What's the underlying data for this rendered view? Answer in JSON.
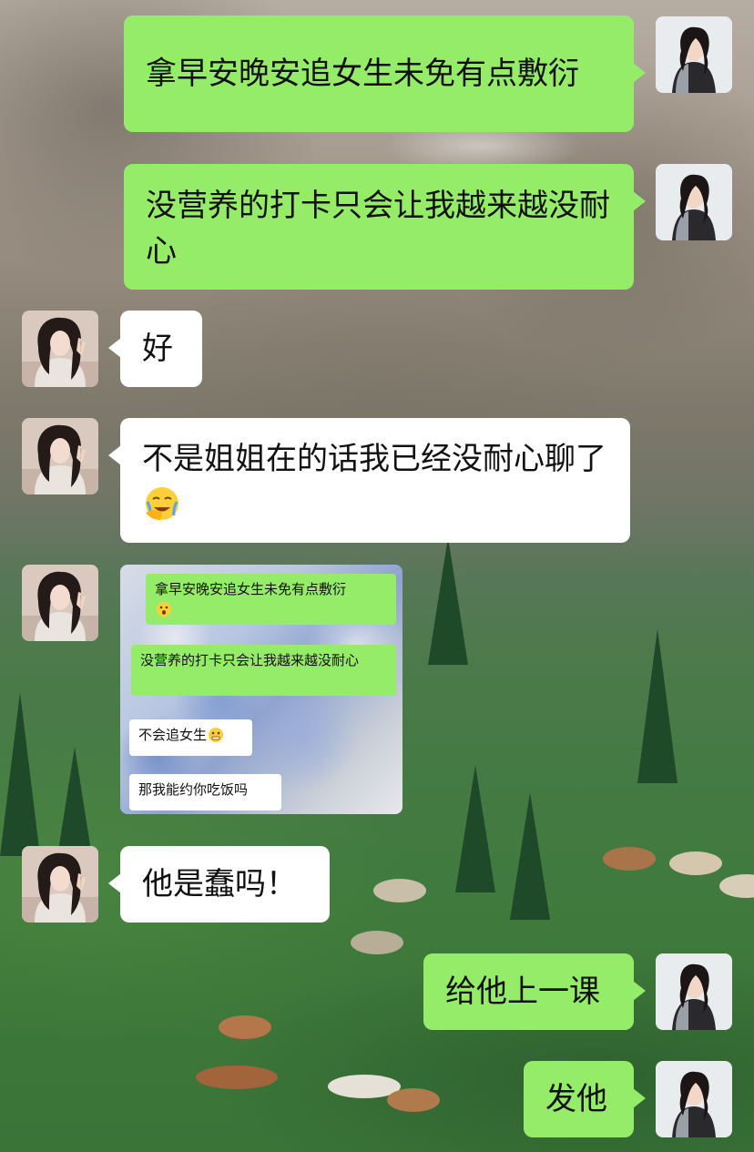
{
  "conversation": {
    "messages": [
      {
        "sender": "me",
        "text": "拿早安晚安追女生未免有点敷衍"
      },
      {
        "sender": "me",
        "text": "没营养的打卡只会让我越来越没耐心"
      },
      {
        "sender": "other",
        "text": "好"
      },
      {
        "sender": "other",
        "text": "不是姐姐在的话我已经没耐心聊了",
        "emoji": "face-palm-crying-emoji"
      },
      {
        "sender": "other",
        "type": "image",
        "image": {
          "messages": [
            {
              "sender": "me",
              "text": "拿早安晚安追女生未免有点敷衍",
              "emoji": "surprised-face-emoji"
            },
            {
              "sender": "me",
              "text": "没营养的打卡只会让我越来越没耐心"
            },
            {
              "sender": "other",
              "text": "不会追女生",
              "emoji": "grimace-face-emoji"
            },
            {
              "sender": "other",
              "text": "那我能约你吃饭吗"
            }
          ]
        }
      },
      {
        "sender": "other",
        "text": "他是蠢吗！"
      },
      {
        "sender": "me",
        "text": "给他上一课"
      },
      {
        "sender": "me",
        "text": "发他"
      }
    ]
  },
  "colors": {
    "my_bubble": "#95ec69",
    "other_bubble": "#ffffff",
    "text": "#111111"
  },
  "icons": {
    "my_avatar": "woman-portrait-avatar",
    "other_avatar": "girl-peace-sign-avatar"
  }
}
